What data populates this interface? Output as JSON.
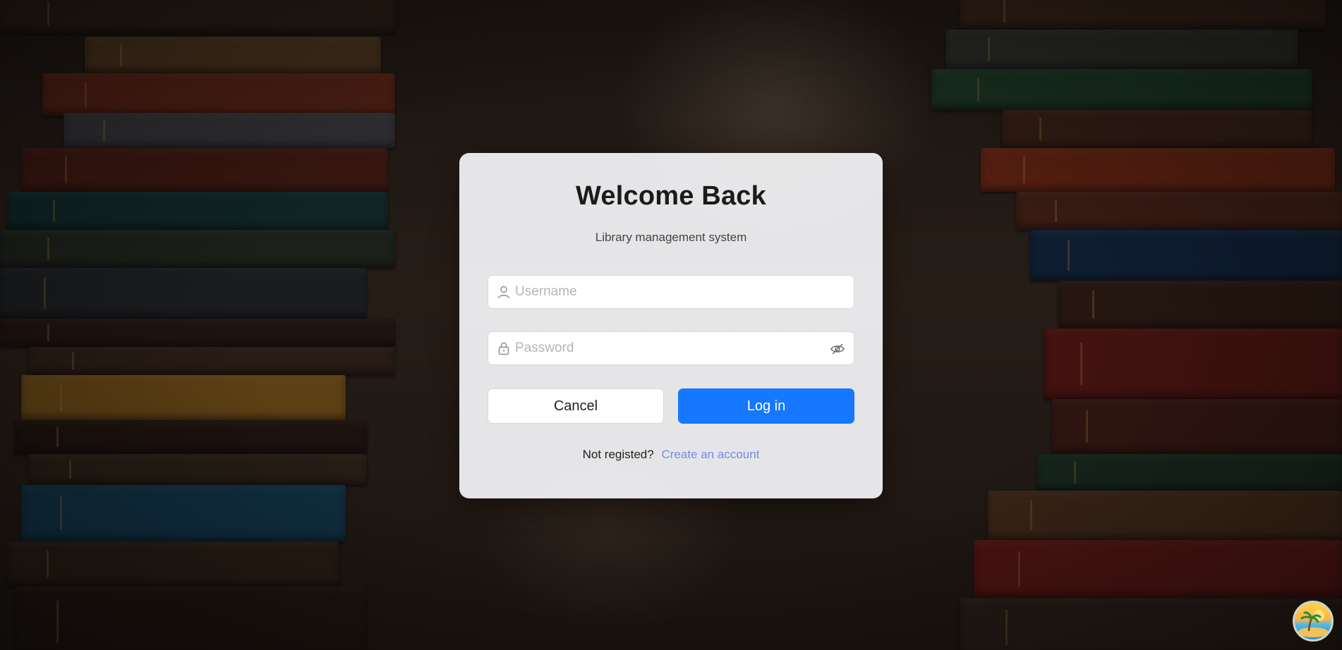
{
  "login": {
    "title": "Welcome Back",
    "subtitle": "Library management system",
    "username_placeholder": "Username",
    "password_placeholder": "Password",
    "cancel_label": "Cancel",
    "login_label": "Log in",
    "not_registered_text": "Not registed?",
    "create_account_label": "Create an account"
  },
  "icons": {
    "username": "user-icon",
    "password": "lock-icon",
    "visibility": "eye-slash-icon",
    "corner_badge": "island-logo-icon"
  },
  "colors": {
    "primary": "#1677ff",
    "link": "#6f8ee8",
    "card_background": "#f0f0f2"
  }
}
